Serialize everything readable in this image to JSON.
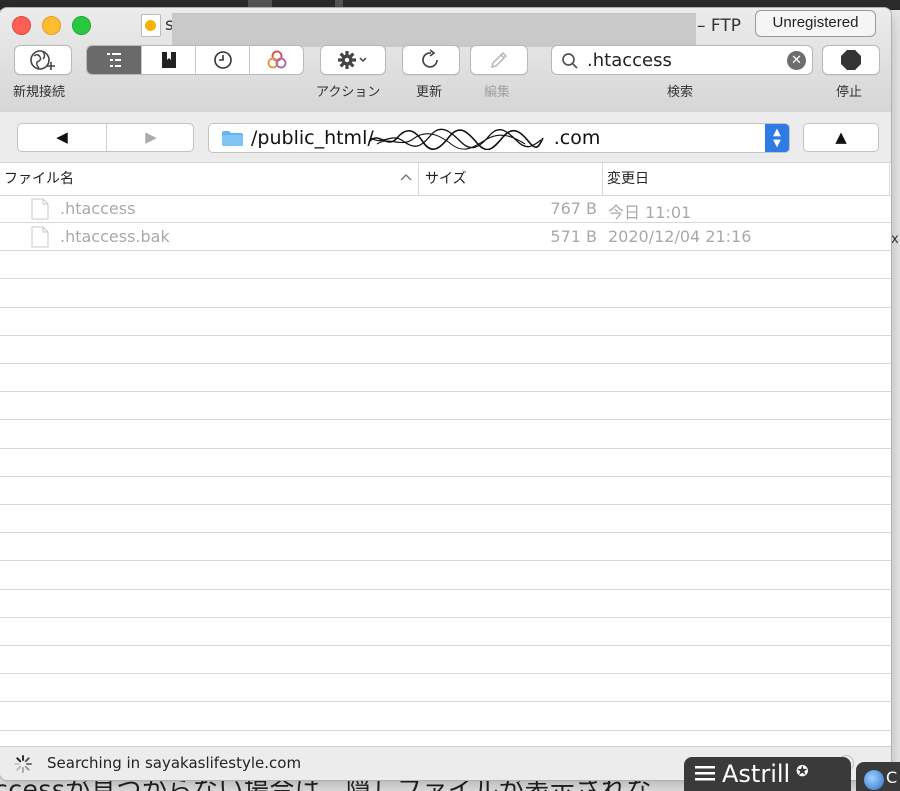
{
  "window": {
    "title_first_char": "s",
    "title_suffix": "– FTP",
    "unregistered_label": "Unregistered"
  },
  "toolbar": {
    "new_connection_label": "新規接続",
    "action_label": "アクション",
    "refresh_label": "更新",
    "edit_label": "編集",
    "search_label": "検索",
    "stop_label": "停止",
    "search_value": ".htaccess"
  },
  "nav": {
    "back_glyph": "◀",
    "forward_glyph": "▶",
    "path_prefix": "/public_html/",
    "path_suffix": ".com",
    "up_glyph": "▲"
  },
  "table": {
    "columns": [
      "ファイル名",
      "サイズ",
      "変更日"
    ],
    "rows": [
      {
        "name": ".htaccess",
        "size": "767 B",
        "modified": "今日 11:01"
      },
      {
        "name": ".htaccess.bak",
        "size": "571 B",
        "modified": "2020/12/04 21:16"
      }
    ]
  },
  "status": {
    "text": "Searching in sayakaslifestyle.com"
  },
  "background": {
    "bottom_text": "ccessが見つからない場合は、隠しファイルが表示されな",
    "right_char": "x"
  },
  "overlay": {
    "astrill_label": "Astrill",
    "astrill_secondary": "C"
  },
  "colors": {
    "accent_blue": "#2f7be6",
    "active_segment": "#6a6a6a",
    "close": "#fd5f57",
    "minimize": "#febc2e",
    "maximize": "#29c840"
  }
}
